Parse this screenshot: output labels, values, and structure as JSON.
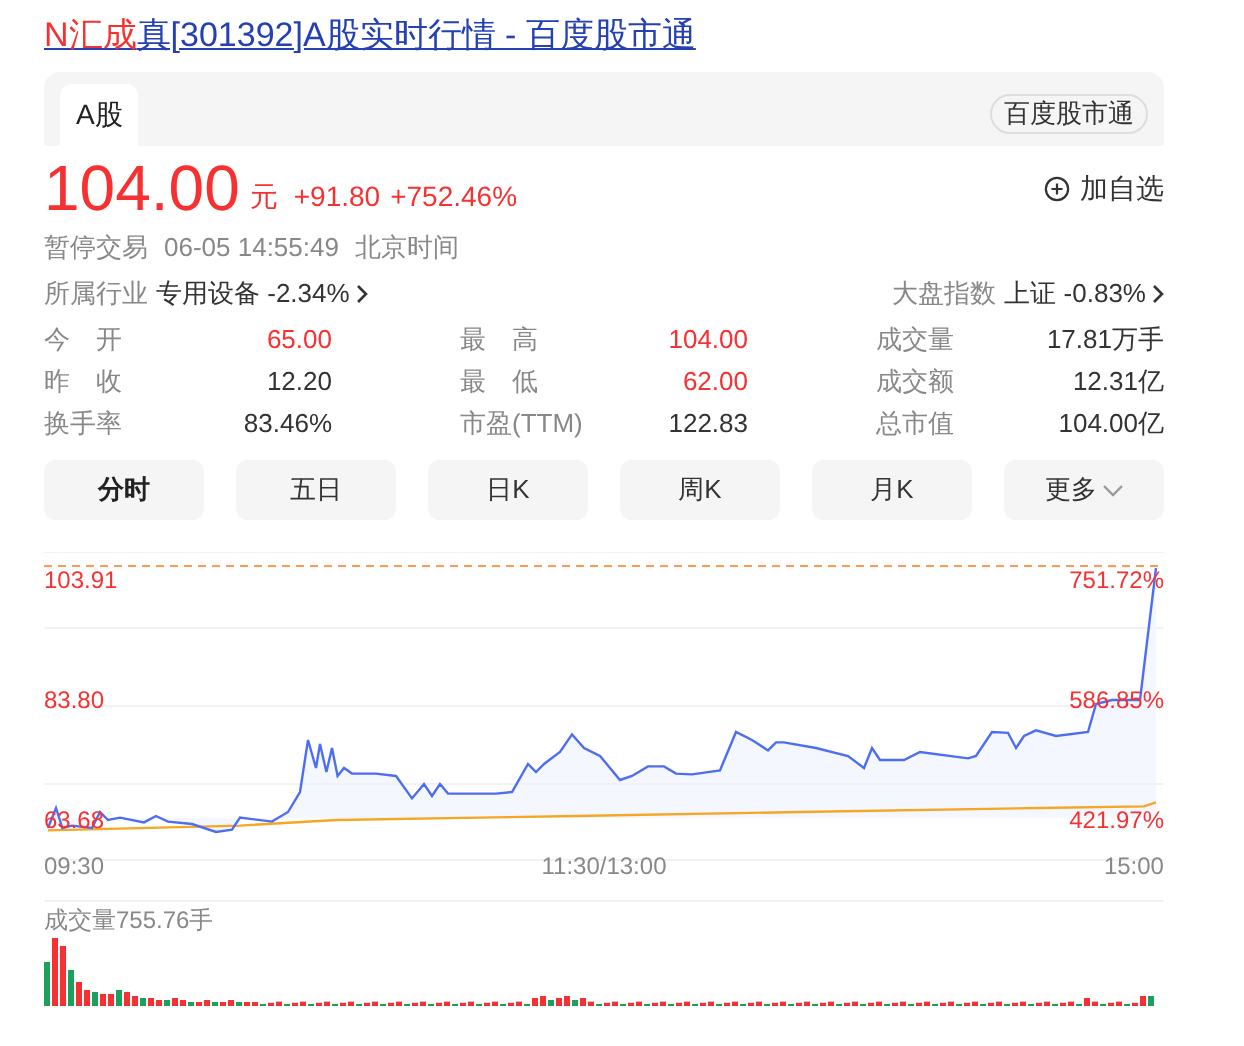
{
  "title": {
    "highlight": "N汇成",
    "rest": "真[301392]A股实时行情 - 百度股市通"
  },
  "market_tabs": [
    {
      "label": "A股",
      "selected": true
    }
  ],
  "source_badge": "百度股市通",
  "quote": {
    "price": "104.00",
    "unit": "元",
    "change": "+91.80",
    "change_pct": "+752.46%"
  },
  "watch_button": "加自选",
  "status": {
    "state": "暂停交易",
    "time": "06-05 14:55:49",
    "zone": "北京时间"
  },
  "industry": {
    "label": "所属行业",
    "name": "专用设备",
    "change": "-2.34%"
  },
  "index": {
    "label": "大盘指数",
    "name": "上证",
    "change": "-0.83%"
  },
  "stats": [
    [
      {
        "label": "今　开",
        "value": "65.00",
        "kind": "up"
      },
      {
        "label": "昨　收",
        "value": "12.20",
        "kind": "plain"
      },
      {
        "label": "换手率",
        "value": "83.46%",
        "kind": "plain"
      }
    ],
    [
      {
        "label": "最　高",
        "value": "104.00",
        "kind": "up"
      },
      {
        "label": "最　低",
        "value": "62.00",
        "kind": "up"
      },
      {
        "label": "市盈(TTM)",
        "value": "122.83",
        "kind": "plain"
      }
    ],
    [
      {
        "label": "成交量",
        "value": "17.81万手",
        "kind": "plain"
      },
      {
        "label": "成交额",
        "value": "12.31亿",
        "kind": "plain"
      },
      {
        "label": "总市值",
        "value": "104.00亿",
        "kind": "plain"
      }
    ]
  ],
  "period_tabs": [
    {
      "label": "分时",
      "selected": true,
      "kind": "tab"
    },
    {
      "label": "五日",
      "selected": false,
      "kind": "tab"
    },
    {
      "label": "日K",
      "selected": false,
      "kind": "tab"
    },
    {
      "label": "周K",
      "selected": false,
      "kind": "tab"
    },
    {
      "label": "月K",
      "selected": false,
      "kind": "tab"
    },
    {
      "label": "更多",
      "selected": false,
      "kind": "menu"
    }
  ],
  "chart": {
    "price_labels": [
      "103.91",
      "83.80",
      "63.68"
    ],
    "pct_labels": [
      "751.72%",
      "586.85%",
      "421.97%"
    ],
    "time_labels": [
      "09:30",
      "11:30/13:00",
      "15:00"
    ],
    "volume_label": "成交量755.76手"
  }
}
